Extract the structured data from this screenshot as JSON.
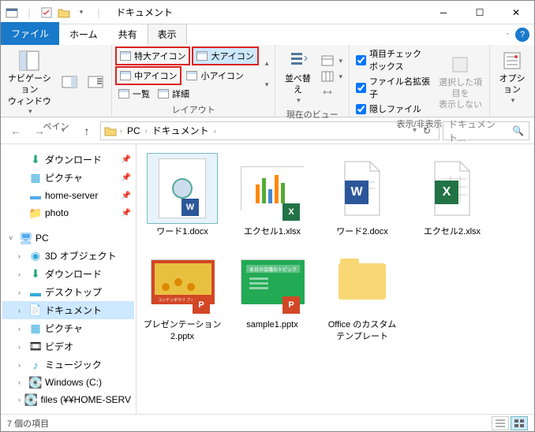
{
  "window": {
    "title": "ドキュメント",
    "minimize": "─",
    "maximize": "☐",
    "close": "✕"
  },
  "tabs": {
    "file": "ファイル",
    "home": "ホーム",
    "share": "共有",
    "view": "表示"
  },
  "ribbon": {
    "pane_group": "ペイン",
    "nav_pane": "ナビゲーション\nウィンドウ",
    "layout": {
      "group": "レイアウト",
      "xlarge": "特大アイコン",
      "large": "大アイコン",
      "medium": "中アイコン",
      "small": "小アイコン",
      "list": "一覧",
      "details": "詳細"
    },
    "current_view": {
      "group": "現在のビュー",
      "sort": "並べ替え"
    },
    "show_hide": {
      "group": "表示/非表示",
      "checkboxes": "項目チェック ボックス",
      "extensions": "ファイル名拡張子",
      "hidden": "隠しファイル",
      "hide_selected": "選択した項目を\n表示しない"
    },
    "options": "オプション"
  },
  "address": {
    "pc": "PC",
    "documents": "ドキュメント",
    "search_placeholder": "ドキュメント..."
  },
  "tree": {
    "downloads": "ダウンロード",
    "pictures": "ピクチャ",
    "home_server": "home-server",
    "photo": "photo",
    "pc": "PC",
    "objects3d": "3D オブジェクト",
    "downloads2": "ダウンロード",
    "desktop": "デスクトップ",
    "documents": "ドキュメント",
    "pictures2": "ピクチャ",
    "video": "ビデオ",
    "music": "ミュージック",
    "cdrive": "Windows (C:)",
    "files": "files (¥¥HOME-SERV"
  },
  "files": [
    {
      "name": "ワード1.docx",
      "type": "word-thumb"
    },
    {
      "name": "エクセル1.xlsx",
      "type": "excel-thumb"
    },
    {
      "name": "ワード2.docx",
      "type": "word-icon"
    },
    {
      "name": "エクセル2.xlsx",
      "type": "excel-icon"
    },
    {
      "name": "プレゼンテーション2.pptx",
      "type": "ppt-thumb1"
    },
    {
      "name": "sample1.pptx",
      "type": "ppt-thumb2"
    },
    {
      "name": "Office のカスタム テンプレート",
      "type": "folder"
    }
  ],
  "status": {
    "count": "7 個の項目"
  }
}
